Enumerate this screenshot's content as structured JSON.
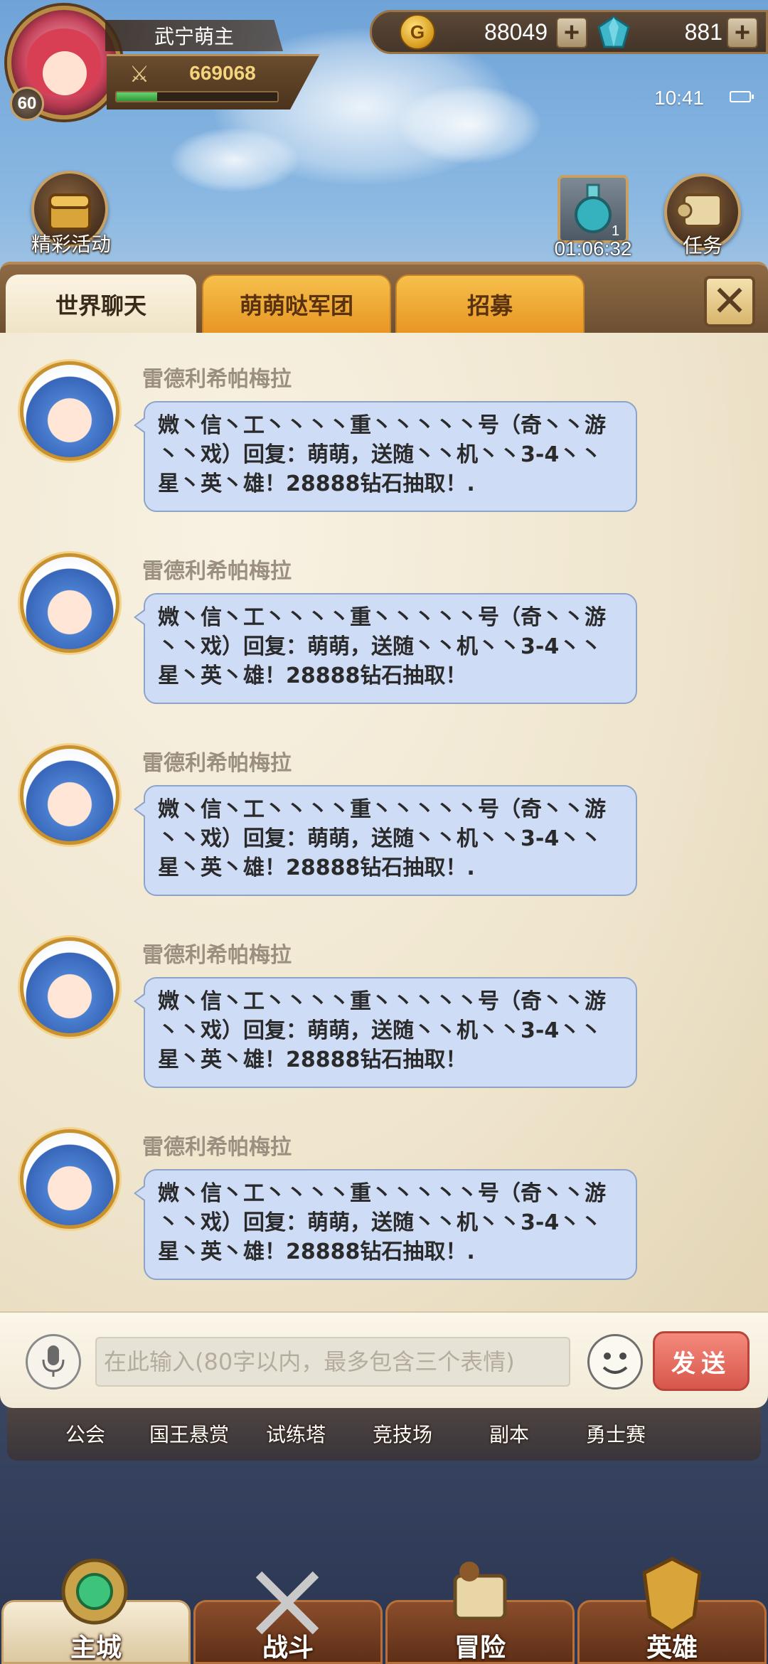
{
  "player": {
    "name": "武宁萌主",
    "level": "60",
    "power": "669068",
    "exp_fraction": 0.25
  },
  "currency": {
    "gold": "88049",
    "gold_icon_letter": "G",
    "diamonds": "881",
    "add_label": "+"
  },
  "status": {
    "time": "10:41"
  },
  "buttons": {
    "activities_label": "精彩活动",
    "quest_label": "任务",
    "potion_count": "1",
    "potion_timer": "01:06:32"
  },
  "chat": {
    "tabs": [
      {
        "label": "世界聊天",
        "active": true
      },
      {
        "label": "萌萌哒军团",
        "active": false
      },
      {
        "label": "招募",
        "active": false
      }
    ],
    "close_label": "✕",
    "messages": [
      {
        "sender": "雷德利希帕梅拉",
        "text": "媺丶信丶工丶丶丶丶重丶丶丶丶丶号（奇丶丶游丶丶戏）回复：萌萌，送随丶丶机丶丶3-4丶丶星丶英丶雄！28888钻石抽取！."
      },
      {
        "sender": "雷德利希帕梅拉",
        "text": "媺丶信丶工丶丶丶丶重丶丶丶丶丶号（奇丶丶游丶丶戏）回复：萌萌，送随丶丶机丶丶3-4丶丶星丶英丶雄！28888钻石抽取！"
      },
      {
        "sender": "雷德利希帕梅拉",
        "text": "媺丶信丶工丶丶丶丶重丶丶丶丶丶号（奇丶丶游丶丶戏）回复：萌萌，送随丶丶机丶丶3-4丶丶星丶英丶雄！28888钻石抽取！."
      },
      {
        "sender": "雷德利希帕梅拉",
        "text": "媺丶信丶工丶丶丶丶重丶丶丶丶丶号（奇丶丶游丶丶戏）回复：萌萌，送随丶丶机丶丶3-4丶丶星丶英丶雄！28888钻石抽取！"
      },
      {
        "sender": "雷德利希帕梅拉",
        "text": "媺丶信丶工丶丶丶丶重丶丶丶丶丶号（奇丶丶游丶丶戏）回复：萌萌，送随丶丶机丶丶3-4丶丶星丶英丶雄！28888钻石抽取！."
      }
    ],
    "input_placeholder": "在此输入(80字以内，最多包含三个表情)",
    "input_value": "",
    "send_label": "发送"
  },
  "shortcuts": [
    {
      "label": "公会"
    },
    {
      "label": "国王悬赏"
    },
    {
      "label": "试练塔"
    },
    {
      "label": "竞技场"
    },
    {
      "label": "副本"
    },
    {
      "label": "勇士赛"
    }
  ],
  "nav": [
    {
      "label": "主城",
      "active": true
    },
    {
      "label": "战斗",
      "active": false
    },
    {
      "label": "冒险",
      "active": false
    },
    {
      "label": "英雄",
      "active": false
    }
  ],
  "colors": {
    "accent_gold": "#f4d57d",
    "bubble": "#cfdcf6",
    "send_button": "#d8564b",
    "tab_inactive": "#e89624"
  }
}
